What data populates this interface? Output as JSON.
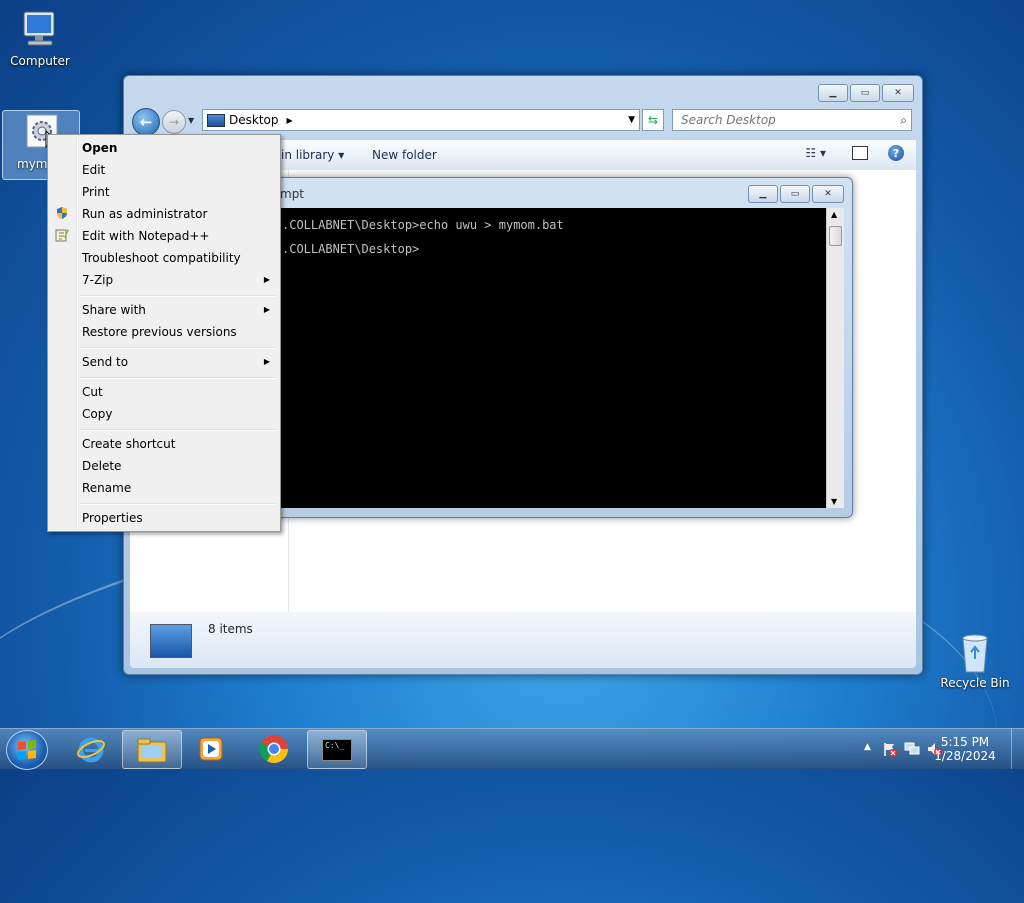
{
  "desktop": {
    "icons": [
      {
        "label": "Computer"
      },
      {
        "label": "mym"
      },
      {
        "label": "Recycle Bin"
      }
    ]
  },
  "explorer": {
    "address": "Desktop",
    "search_placeholder": "Search Desktop",
    "toolbar": {
      "include_in_library": "in library",
      "new_folder": "New folder"
    },
    "details": {
      "item_count": "8 items"
    }
  },
  "cmd": {
    "title": "mpt",
    "lines": [
      ".COLLABNET\\Desktop>echo uwu > mymom.bat",
      ".COLLABNET\\Desktop>"
    ]
  },
  "context_menu": {
    "items": [
      {
        "label": "Open",
        "bold": true
      },
      {
        "label": "Edit"
      },
      {
        "label": "Print"
      },
      {
        "label": "Run as administrator",
        "icon": "shield-icon"
      },
      {
        "label": "Edit with Notepad++",
        "icon": "notepad-icon"
      },
      {
        "label": "Troubleshoot compatibility"
      },
      {
        "label": "7-Zip",
        "submenu": true
      },
      {
        "label": "Share with",
        "submenu": true
      },
      {
        "label": "Restore previous versions"
      },
      {
        "label": "Send to",
        "submenu": true
      },
      {
        "label": "Cut"
      },
      {
        "label": "Copy"
      },
      {
        "label": "Create shortcut"
      },
      {
        "label": "Delete"
      },
      {
        "label": "Rename"
      },
      {
        "label": "Properties"
      }
    ]
  },
  "taskbar": {
    "clock_time": "5:15 PM",
    "clock_date": "1/28/2024",
    "apps": [
      "internet-explorer-icon",
      "explorer-icon",
      "media-player-icon",
      "chrome-icon",
      "cmd-icon"
    ],
    "cmd_icon_text": "C:\\_"
  },
  "colors": {
    "wallpaper": "#1f7fd1",
    "menu_bg": "#f0f0f0",
    "console_bg": "#000000",
    "console_fg": "#c0c0c0"
  }
}
